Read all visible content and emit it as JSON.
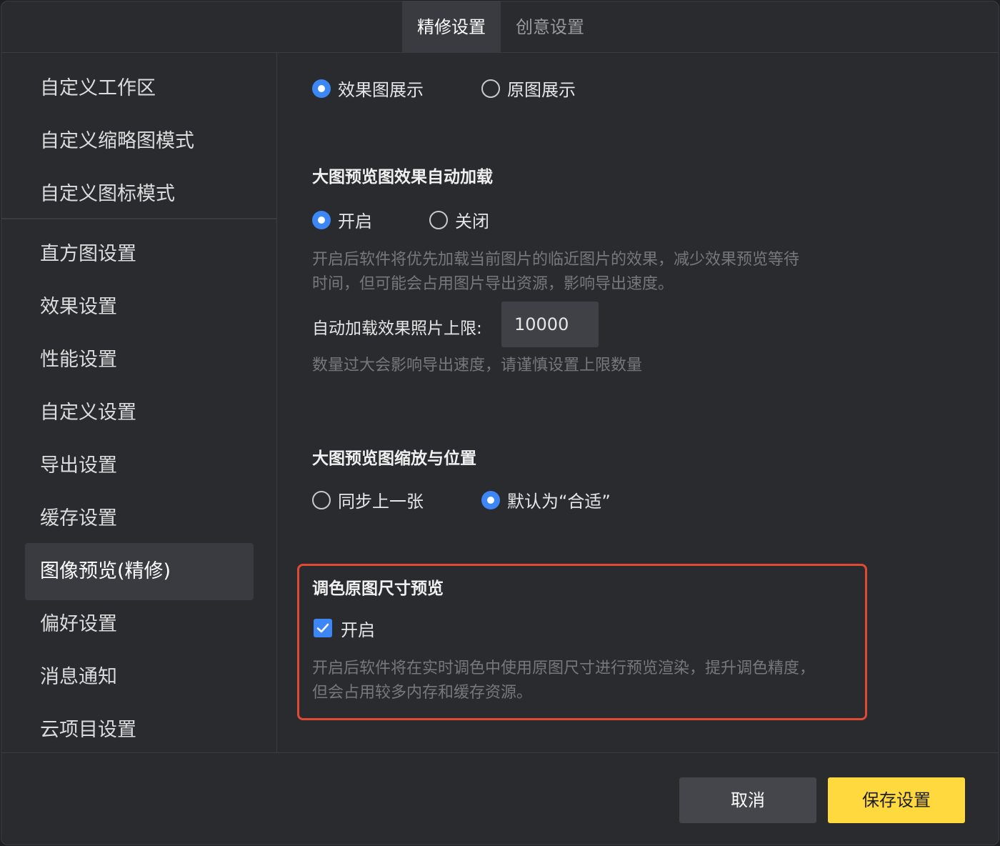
{
  "tabs": [
    {
      "label": "精修设置",
      "active": true
    },
    {
      "label": "创意设置",
      "active": false
    }
  ],
  "sidebar": {
    "group1": [
      "自定义工作区",
      "自定义缩略图模式",
      "自定义图标模式"
    ],
    "group2": [
      "直方图设置",
      "效果设置",
      "性能设置",
      "自定义设置",
      "导出设置",
      "缓存设置",
      "图像预览(精修)",
      "偏好设置",
      "消息通知",
      "云项目设置"
    ],
    "active_item": "图像预览(精修)"
  },
  "content": {
    "display_mode": {
      "options": [
        "效果图展示",
        "原图展示"
      ],
      "selected": "效果图展示"
    },
    "auto_load": {
      "title": "大图预览图效果自动加载",
      "options": [
        "开启",
        "关闭"
      ],
      "selected": "开启",
      "hint_line1": "开启后软件将优先加载当前图片的临近图片的效果，减少效果预览等待",
      "hint_line2": "时间，但可能会占用图片导出资源，影响导出速度。",
      "limit_label": "自动加载效果照片上限:",
      "limit_value": "10000",
      "limit_hint": "数量过大会影响导出速度，请谨慎设置上限数量"
    },
    "zoom_position": {
      "title": "大图预览图缩放与位置",
      "options": [
        "同步上一张",
        "默认为“合适”"
      ],
      "selected": "默认为“合适”"
    },
    "original_size_preview": {
      "title": "调色原图尺寸预览",
      "checkbox_label": "开启",
      "checked": true,
      "hint_line1": "开启后软件将在实时调色中使用原图尺寸进行预览渲染，提升调色精度，",
      "hint_line2": "但会占用较多内存和缓存资源。"
    }
  },
  "footer": {
    "cancel_label": "取消",
    "save_label": "保存设置"
  },
  "colors": {
    "accent_blue": "#3c86f5",
    "highlight_red": "#e04a33",
    "save_yellow": "#ffd93d"
  }
}
